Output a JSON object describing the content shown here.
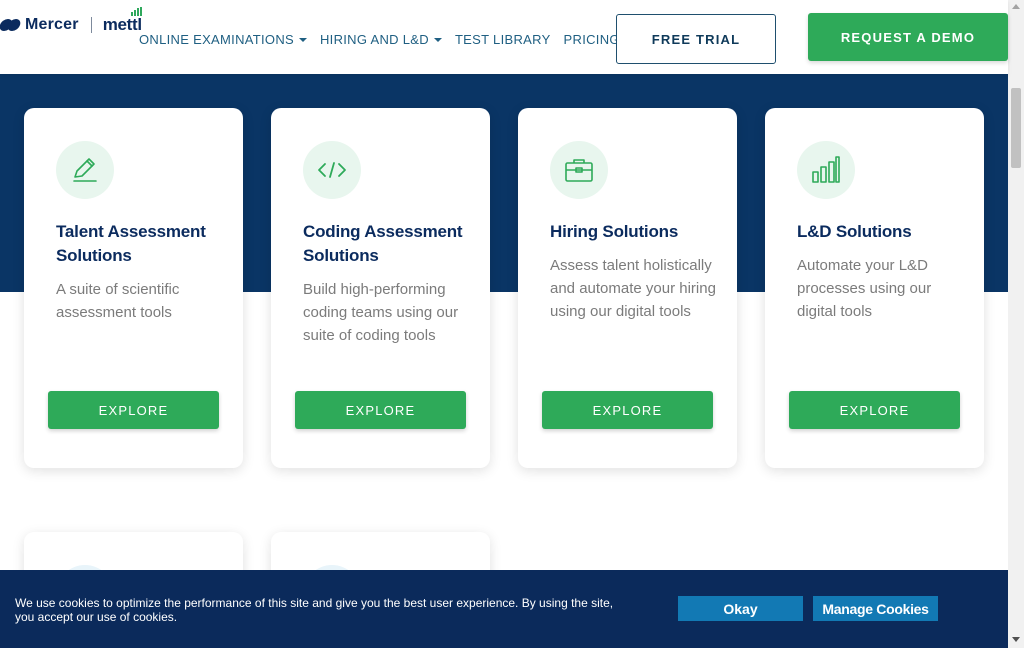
{
  "header": {
    "logo": {
      "brand": "Mercer",
      "product": "mettl"
    },
    "nav": [
      {
        "label": "ONLINE EXAMINATIONS",
        "dropdown": true
      },
      {
        "label": "HIRING AND L&D",
        "dropdown": true
      },
      {
        "label": "TEST LIBRARY",
        "dropdown": false
      },
      {
        "label": "PRICING",
        "dropdown": false
      }
    ],
    "free_trial_label": "FREE TRIAL",
    "request_demo_label": "REQUEST A DEMO"
  },
  "cards": [
    {
      "icon": "pencil-icon",
      "title": "Talent Assessment Solutions",
      "description": "A suite of scientific assessment tools",
      "button": "EXPLORE"
    },
    {
      "icon": "code-icon",
      "title": "Coding Assessment Solutions",
      "description": "Build high-performing coding teams using our suite of coding tools",
      "button": "EXPLORE"
    },
    {
      "icon": "briefcase-icon",
      "title": "Hiring Solutions",
      "description": "Assess talent holistically and automate your hiring using our digital tools",
      "button": "EXPLORE"
    },
    {
      "icon": "bar-chart-icon",
      "title": "L&D Solutions",
      "description": "Automate your L&D processes using our digital tools",
      "button": "EXPLORE"
    }
  ],
  "cookie_banner": {
    "text": "We use cookies to optimize the performance of this site and give you the best user experience. By using the site, you accept our use of cookies.",
    "okay_label": "Okay",
    "manage_label": "Manage Cookies"
  },
  "colors": {
    "navy": "#0a3565",
    "green": "#2eaa59",
    "cookie_bg": "#0b2a5b",
    "cookie_button": "#1279b4"
  }
}
